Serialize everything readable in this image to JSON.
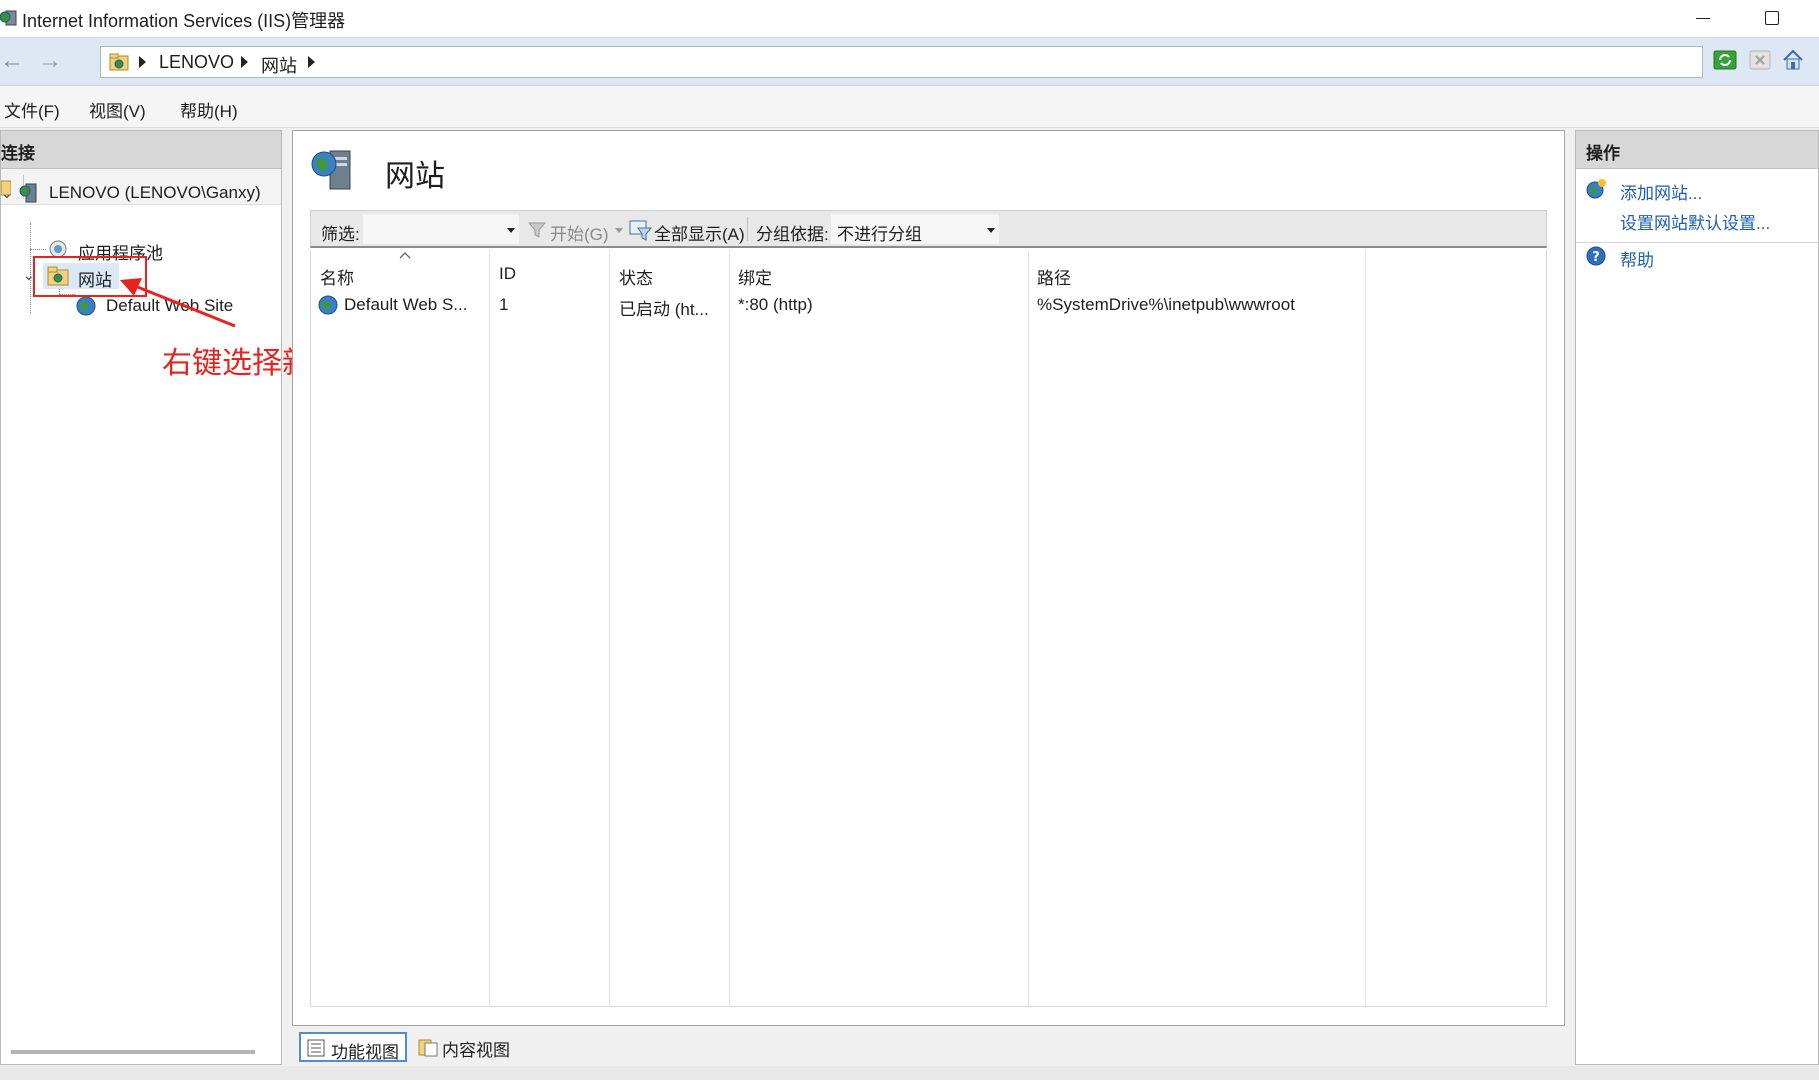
{
  "window": {
    "title": "Internet Information Services (IIS)管理器",
    "minimize_icon": "minimize-icon",
    "maximize_icon": "maximize-icon"
  },
  "addressbar": {
    "crumbs": [
      "LENOVO",
      "网站"
    ],
    "icons": [
      "refresh-icon",
      "stop-icon",
      "home-icon"
    ]
  },
  "menubar": {
    "items": [
      "文件(F)",
      "视图(V)",
      "帮助(H)"
    ]
  },
  "connections": {
    "header": "连接",
    "tree": {
      "server": "LENOVO (LENOVO\\Ganxy)",
      "app_pools": "应用程序池",
      "sites": "网站",
      "site1": "Default Web Site"
    }
  },
  "annotation": {
    "text": "右键选择新建网站",
    "color": "#e8231f"
  },
  "center": {
    "title": "网站",
    "filterbar": {
      "filter_label": "筛选:",
      "start_label": "开始(G)",
      "show_all_label": "全部显示(A)",
      "group_by_label": "分组依据:",
      "group_by_value": "不进行分组"
    },
    "columns": [
      "名称",
      "ID",
      "状态",
      "绑定",
      "路径"
    ],
    "rows": [
      {
        "name": "Default Web S...",
        "id": "1",
        "status": "已启动 (ht...",
        "binding": "*:80 (http)",
        "path": "%SystemDrive%\\inetpub\\wwwroot"
      }
    ]
  },
  "bottom_tabs": [
    "功能视图",
    "内容视图"
  ],
  "actions": {
    "header": "操作",
    "items": [
      "添加网站...",
      "设置网站默认设置...",
      "帮助"
    ],
    "link_color": "#1f5fb2"
  }
}
